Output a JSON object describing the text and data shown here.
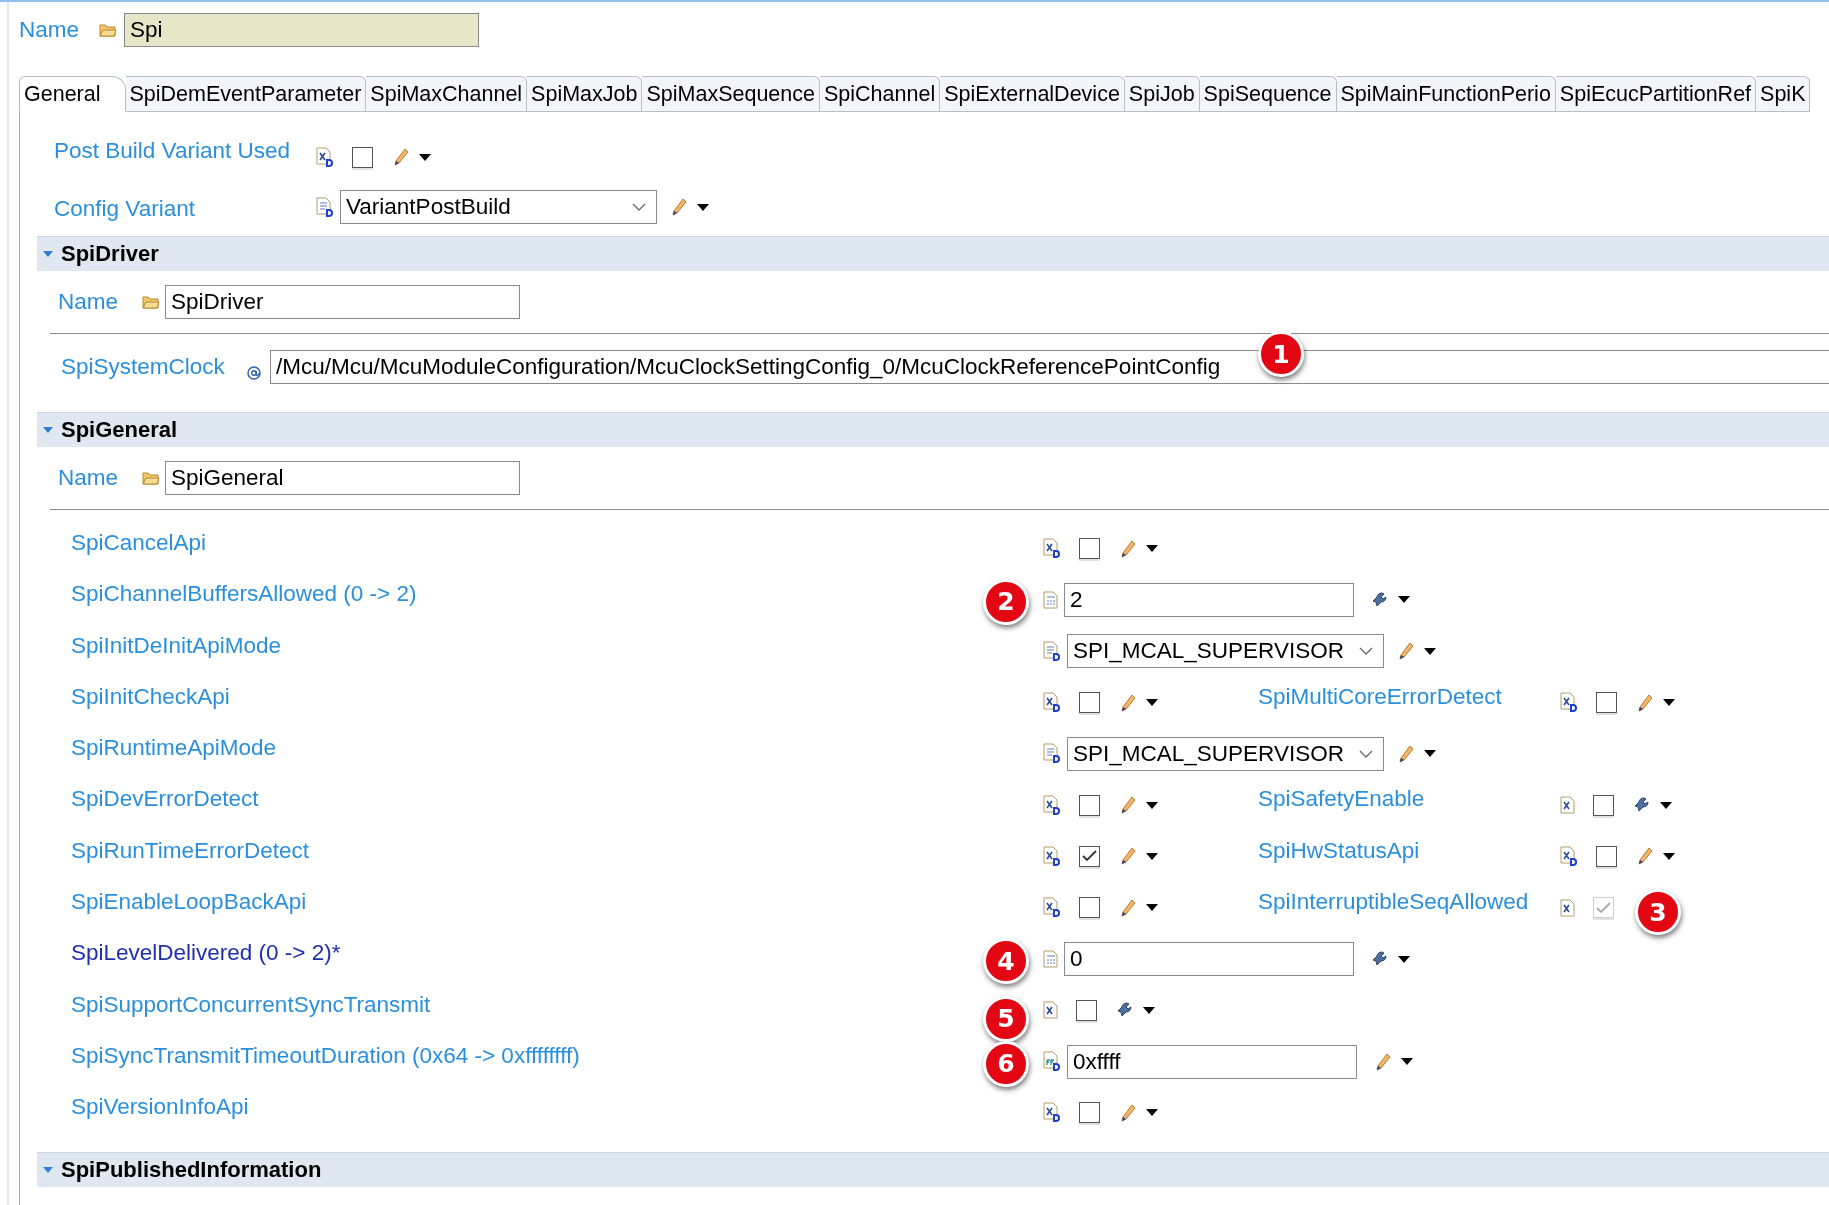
{
  "name_field": {
    "label": "Name",
    "value": "Spi"
  },
  "tabs": [
    {
      "label": "General",
      "selected": true
    },
    {
      "label": "SpiDemEventParameter",
      "selected": false
    },
    {
      "label": "SpiMaxChannel",
      "selected": false
    },
    {
      "label": "SpiMaxJob",
      "selected": false
    },
    {
      "label": "SpiMaxSequence",
      "selected": false
    },
    {
      "label": "SpiChannel",
      "selected": false
    },
    {
      "label": "SpiExternalDevice",
      "selected": false
    },
    {
      "label": "SpiJob",
      "selected": false
    },
    {
      "label": "SpiSequence",
      "selected": false
    },
    {
      "label": "SpiMainFunctionPerio",
      "selected": false
    },
    {
      "label": "SpiEcucPartitionRef",
      "selected": false
    },
    {
      "label": "SpiK",
      "selected": false
    }
  ],
  "general": [
    {
      "kind": "checkbox",
      "label": "Post Build Variant Used",
      "checked": false,
      "variant_badge": true,
      "derived": false
    },
    {
      "kind": "combo",
      "label": "Config Variant",
      "value": "VariantPostBuild",
      "derived": false
    }
  ],
  "sections": [
    {
      "title": "SpiDriver",
      "expanded": true,
      "name_field": {
        "label": "Name",
        "value": "SpiDriver"
      },
      "reference": {
        "label": "SpiSystemClock",
        "value": "/Mcu/Mcu/McuModuleConfiguration/McuClockSettingConfig_0/McuClockReferencePointConfig",
        "callout": "1"
      }
    },
    {
      "title": "SpiGeneral",
      "expanded": true,
      "name_field": {
        "label": "Name",
        "value": "SpiGeneral"
      },
      "params": [
        {
          "kind": "checkbox",
          "label": "SpiCancelApi",
          "checked": false,
          "variant_badge": true,
          "derived": false
        },
        {
          "kind": "number",
          "label": "SpiChannelBuffersAllowed (0 -> 2)",
          "value": "2",
          "derived": true,
          "callout": "2"
        },
        {
          "kind": "combo",
          "label": "SpiInitDeInitApiMode",
          "value": "SPI_MCAL_SUPERVISOR",
          "derived": false
        },
        {
          "kind": "checkbox",
          "label": "SpiInitCheckApi",
          "checked": false,
          "variant_badge": true,
          "derived": false,
          "side": {
            "kind": "checkbox",
            "label": "SpiMultiCoreErrorDetect",
            "checked": false,
            "variant_badge": true,
            "derived": false
          }
        },
        {
          "kind": "combo",
          "label": "SpiRuntimeApiMode",
          "value": "SPI_MCAL_SUPERVISOR",
          "derived": false
        },
        {
          "kind": "checkbox",
          "label": "SpiDevErrorDetect",
          "checked": false,
          "variant_badge": true,
          "derived": false,
          "side": {
            "kind": "checkbox",
            "label": "SpiSafetyEnable",
            "checked": false,
            "variant_badge": false,
            "derived": true
          }
        },
        {
          "kind": "checkbox",
          "label": "SpiRunTimeErrorDetect",
          "checked": true,
          "variant_badge": true,
          "derived": false,
          "side": {
            "kind": "checkbox",
            "label": "SpiHwStatusApi",
            "checked": false,
            "variant_badge": true,
            "derived": false
          }
        },
        {
          "kind": "checkbox",
          "label": "SpiEnableLoopBackApi",
          "checked": false,
          "variant_badge": true,
          "derived": false,
          "side": {
            "kind": "checkbox",
            "label": "SpiInterruptibleSeqAllowed",
            "checked": true,
            "disabled": true,
            "variant_badge": false,
            "callout": "3"
          }
        },
        {
          "kind": "number",
          "label": "SpiLevelDelivered (0 -> 2)*",
          "value": "0",
          "emphasized": true,
          "derived": true,
          "callout": "4"
        },
        {
          "kind": "checkbox",
          "label": "SpiSupportConcurrentSyncTransmit",
          "checked": false,
          "variant_badge": false,
          "derived": true,
          "callout": "5"
        },
        {
          "kind": "hex",
          "label": "SpiSyncTransmitTimeoutDuration (0x64 -> 0xffffffff)",
          "value": "0xffff",
          "derived": false,
          "callout": "6"
        },
        {
          "kind": "checkbox",
          "label": "SpiVersionInfoApi",
          "checked": false,
          "variant_badge": true,
          "derived": false
        }
      ]
    },
    {
      "title": "SpiPublishedInformation",
      "expanded": true
    }
  ]
}
